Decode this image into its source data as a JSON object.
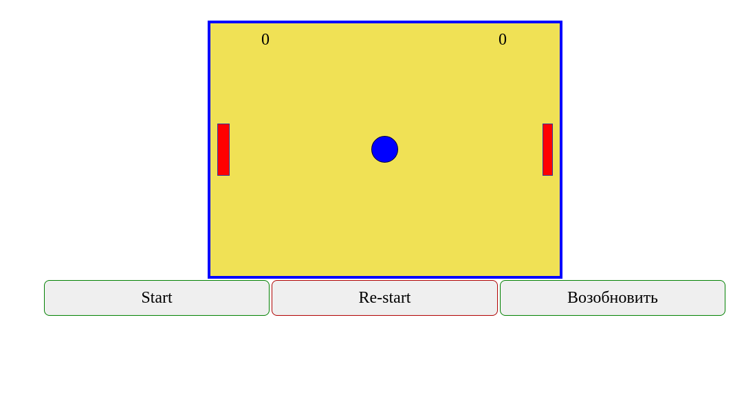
{
  "game": {
    "score_left": "0",
    "score_right": "0"
  },
  "controls": {
    "start_label": "Start",
    "restart_label": "Re-start",
    "resume_label": "Возобновить"
  },
  "colors": {
    "field_background": "#f0e155",
    "field_border": "#0000ff",
    "paddle": "#ff0000",
    "ball": "#0000ff",
    "button_background": "#efefef",
    "start_border": "#008000",
    "restart_border": "#b00000",
    "resume_border": "#008000"
  }
}
